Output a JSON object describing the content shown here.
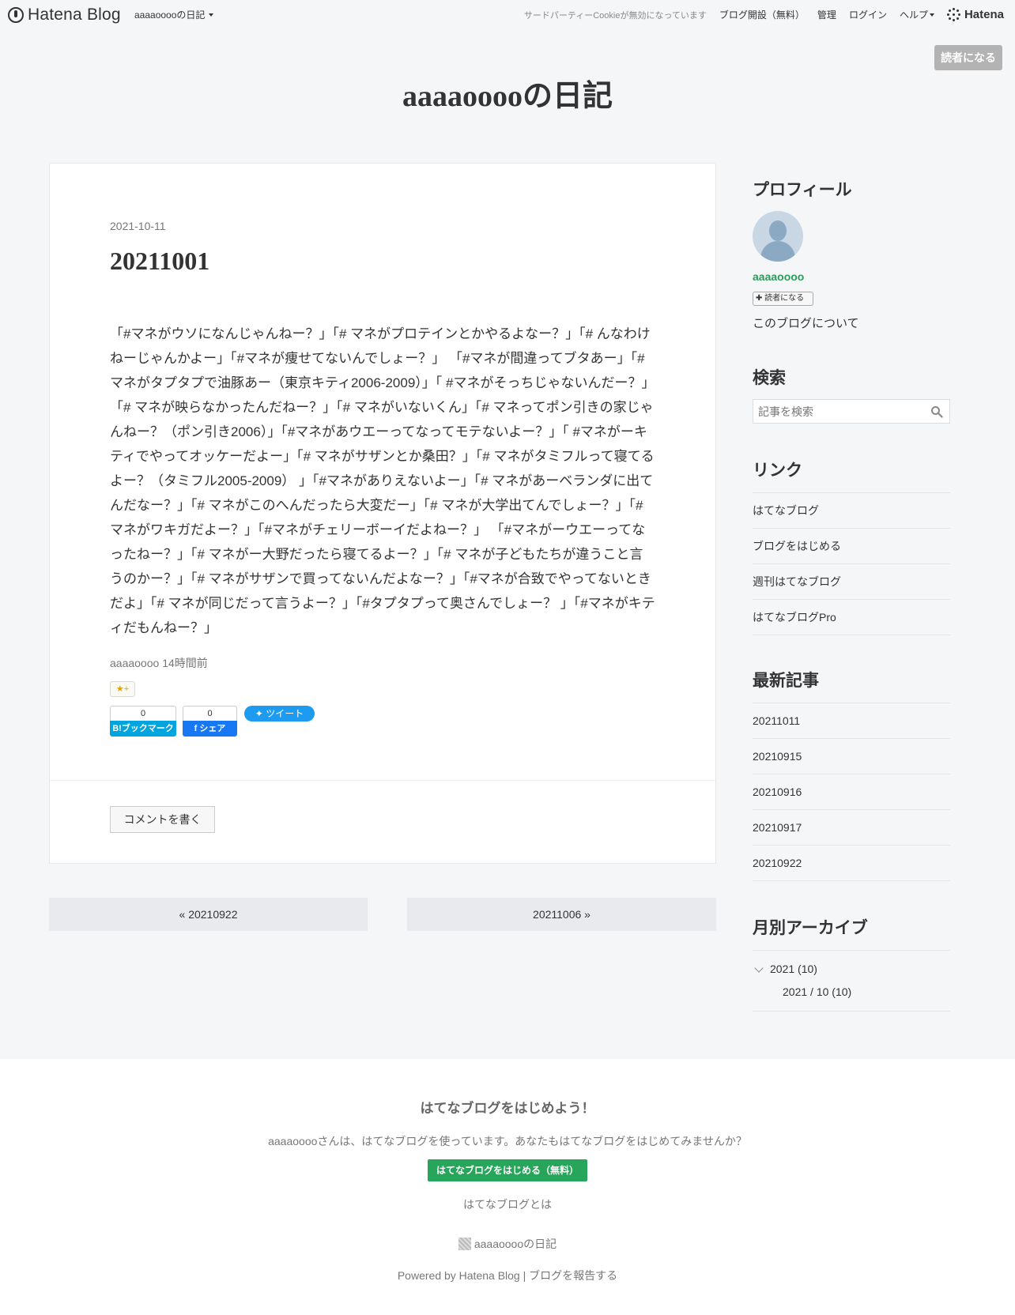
{
  "topbar": {
    "logo_text": "Hatena Blog",
    "blog_menu": "aaaaooooの日記",
    "cookie_note": "サードパーティーCookieが無効になっています",
    "open_blog": "ブログ開設（無料）",
    "manage": "管理",
    "login": "ログイン",
    "help": "ヘルプ",
    "brand": "Hatena"
  },
  "subscribe_top": "読者になる",
  "blog_title": "aaaaooooの日記",
  "entry": {
    "date": "2021-10-11",
    "title": "20211001",
    "body": "「#マネがウソになんじゃんねー？」「# マネがプロテインとかやるよなー？」「# んなわけねーじゃんかよー」「#マネが痩せてないんでしょー？」 「#マネが間違ってブタあー」「# マネがタプタプで油豚あー（東京キティ2006-2009）」「 #マネがそっちじゃないんだー？」「# マネが映らなかったんだねー？」「# マネがいないくん」「# マネってポン引きの家じゃんねー？（ポン引き2006）」「#マネがあウエーってなってモテないよー？」「 #マネがーキティでやってオッケーだよー」「# マネがサザンとか桑田？」「# マネがタミフルって寝てるよー？（タミフル2005-2009） 」「#マネがありえないよー」「# マネがあーベランダに出てんだなー？」「# マネがこのへんだったら大変だー」「# マネが大学出てんでしょー？」「# マネがワキガだよー？」「#マネがチェリーボーイだよねー？」 「#マネがーウエーってなったねー？」「# マネがー大野だったら寝てるよー？」「# マネが子どもたちが違うこと言うのかー？」「# マネがサザンで買ってないんだよなー？」「#マネが合致でやってないときだよ」「# マネが同じだって言うよー？」「#タプタプって奥さんでしょー？ 」「#マネがキティだもんねー？」",
    "author": "aaaaoooo",
    "time_ago": "14時間前",
    "star_label": "★+",
    "bookmark_count": "0",
    "bookmark_label": "B!ブックマーク",
    "facebook_count": "0",
    "facebook_label": "f シェア",
    "tweet_label": "ツイート",
    "comment_button": "コメントを書く"
  },
  "pager": {
    "prev": "« 20210922",
    "next": "20211006 »"
  },
  "sidebar": {
    "profile": {
      "title": "プロフィール",
      "name": "aaaaoooo",
      "subscribe": "✚ 読者になる",
      "about": "このブログについて"
    },
    "search": {
      "title": "検索",
      "placeholder": "記事を検索"
    },
    "links": {
      "title": "リンク",
      "items": [
        "はてなブログ",
        "ブログをはじめる",
        "週刊はてなブログ",
        "はてなブログPro"
      ]
    },
    "recent": {
      "title": "最新記事",
      "items": [
        "20211011",
        "20210915",
        "20210916",
        "20210917",
        "20210922"
      ]
    },
    "archive": {
      "title": "月別アーカイブ",
      "year": "2021 (10)",
      "month": "2021 / 10 (10)"
    }
  },
  "footer": {
    "heading": "はてなブログをはじめよう！",
    "text": "aaaaooooさんは、はてなブログを使っています。あなたもはてなブログをはじめてみませんか？",
    "cta": "はてなブログをはじめる（無料）",
    "about": "はてなブログとは",
    "blog_name": "aaaaooooの日記",
    "powered": "Powered by Hatena Blog | ブログを報告する"
  },
  "colors": {
    "background": "#f5f6f8",
    "profile_name": "#2a9e5b",
    "cta_green": "#27a55b",
    "bookmark_blue": "#00a4de",
    "facebook_blue": "#1877f2",
    "twitter_blue": "#1d9bf0"
  }
}
